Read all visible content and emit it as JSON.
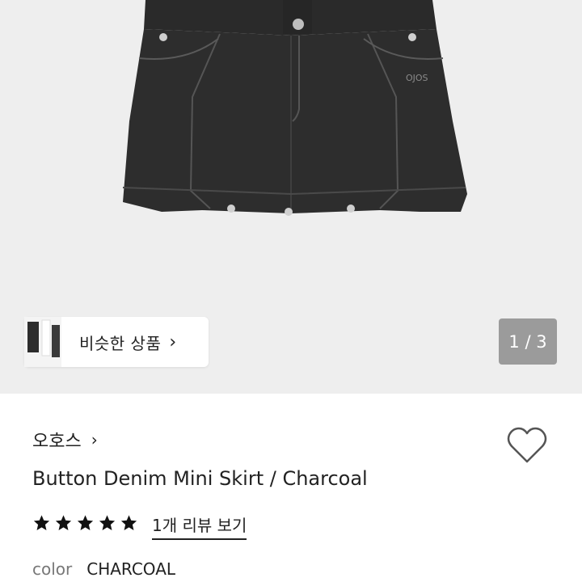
{
  "gallery": {
    "similar_products_label": "비슷한 상품",
    "page_indicator": "1 / 3"
  },
  "product": {
    "seller_name": "오호스",
    "title": "Button Denim Mini Skirt / Charcoal",
    "rating_stars": 5,
    "review_link": "1개 리뷰 보기",
    "color_label": "color",
    "color_value": "CHARCOAL",
    "brand_tag": "OJOS"
  },
  "icons": {
    "chevron": "chevron-right-icon",
    "heart": "heart-outline-icon",
    "star": "star-filled-icon"
  },
  "colors": {
    "hero_bg": "#eeeeee",
    "denim": "#2c2c2c",
    "pager_bg": "#9b9b9b",
    "text": "#222222"
  }
}
